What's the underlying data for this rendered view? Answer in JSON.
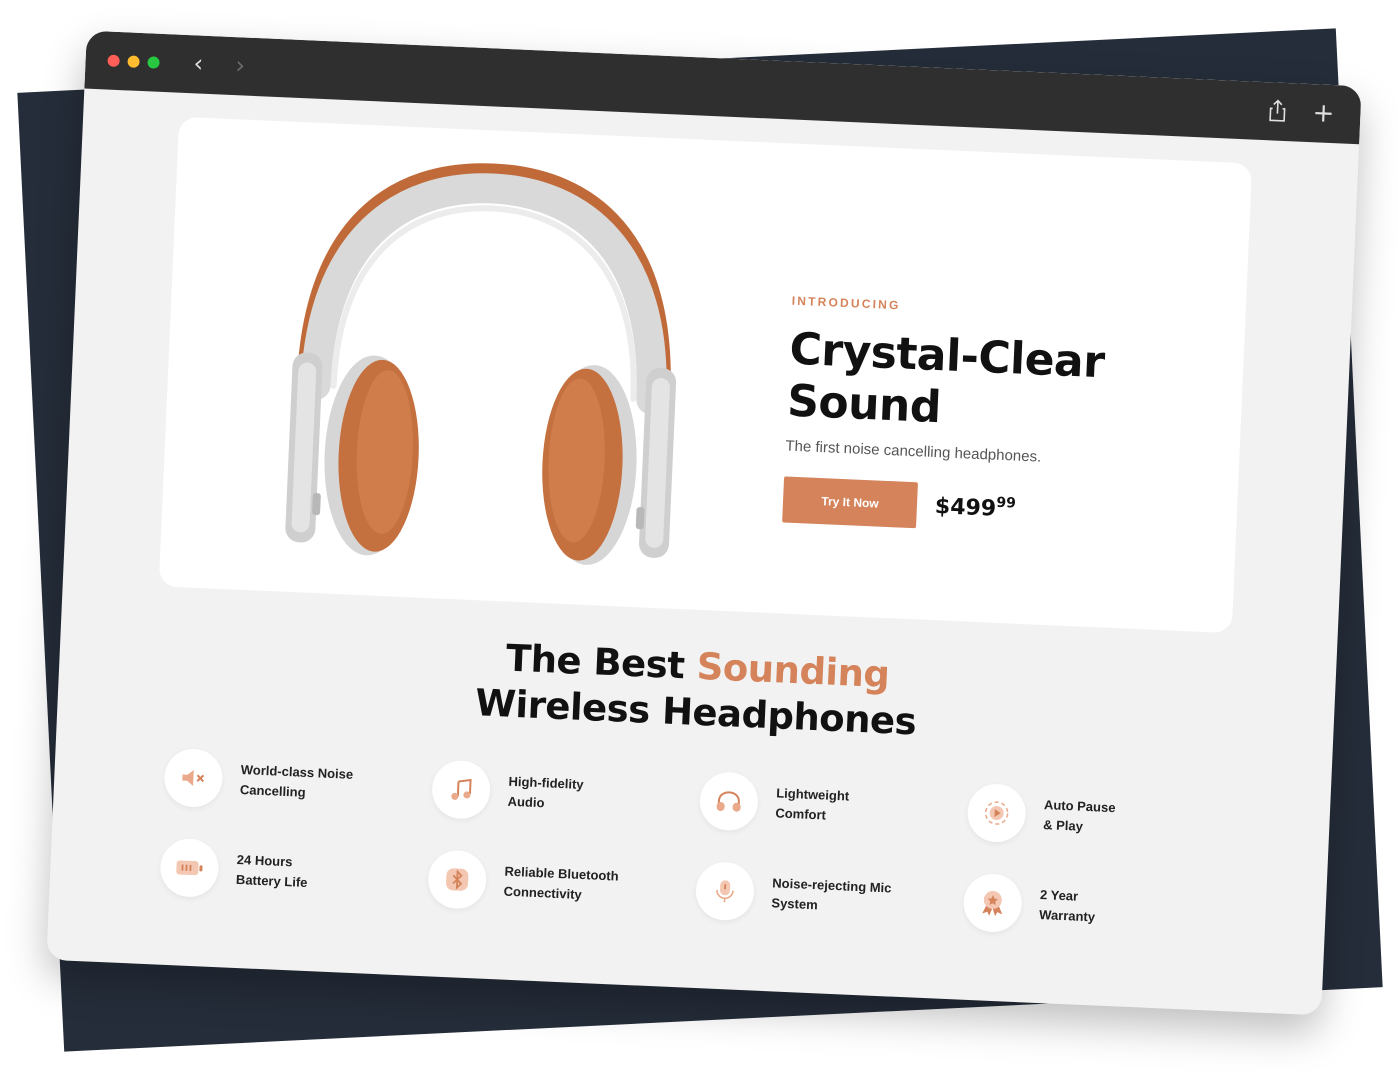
{
  "browser": {
    "back_symbol": "‹",
    "forward_symbol": "›",
    "plus_symbol": "+"
  },
  "hero": {
    "eyebrow": "INTRODUCING",
    "headline_line1": "Crystal-Clear",
    "headline_line2": "Sound",
    "subline": "The first noise cancelling headphones.",
    "cta_label": "Try It Now",
    "price_main": "$499",
    "price_cents": "99"
  },
  "section": {
    "title_part1": "The Best ",
    "title_accent": "Sounding",
    "title_line2": "Wireless Headphones"
  },
  "features": [
    {
      "label_line1": "World-class Noise",
      "label_line2": "Cancelling",
      "icon": "speaker-mute-icon"
    },
    {
      "label_line1": "High-fidelity",
      "label_line2": "Audio",
      "icon": "music-note-icon"
    },
    {
      "label_line1": "Lightweight",
      "label_line2": "Comfort",
      "icon": "headphones-icon"
    },
    {
      "label_line1": "Auto Pause",
      "label_line2": "& Play",
      "icon": "play-icon"
    },
    {
      "label_line1": "24 Hours",
      "label_line2": "Battery Life",
      "icon": "battery-icon"
    },
    {
      "label_line1": "Reliable Bluetooth",
      "label_line2": "Connectivity",
      "icon": "bluetooth-icon"
    },
    {
      "label_line1": "Noise-rejecting Mic",
      "label_line2": "System",
      "icon": "microphone-icon"
    },
    {
      "label_line1": "2 Year",
      "label_line2": "Warranty",
      "icon": "award-icon"
    }
  ],
  "colors": {
    "accent": "#d4835a",
    "backdrop": "#252d3a",
    "titlebar": "#2f2f2f",
    "page_bg": "#f2f2f2"
  }
}
